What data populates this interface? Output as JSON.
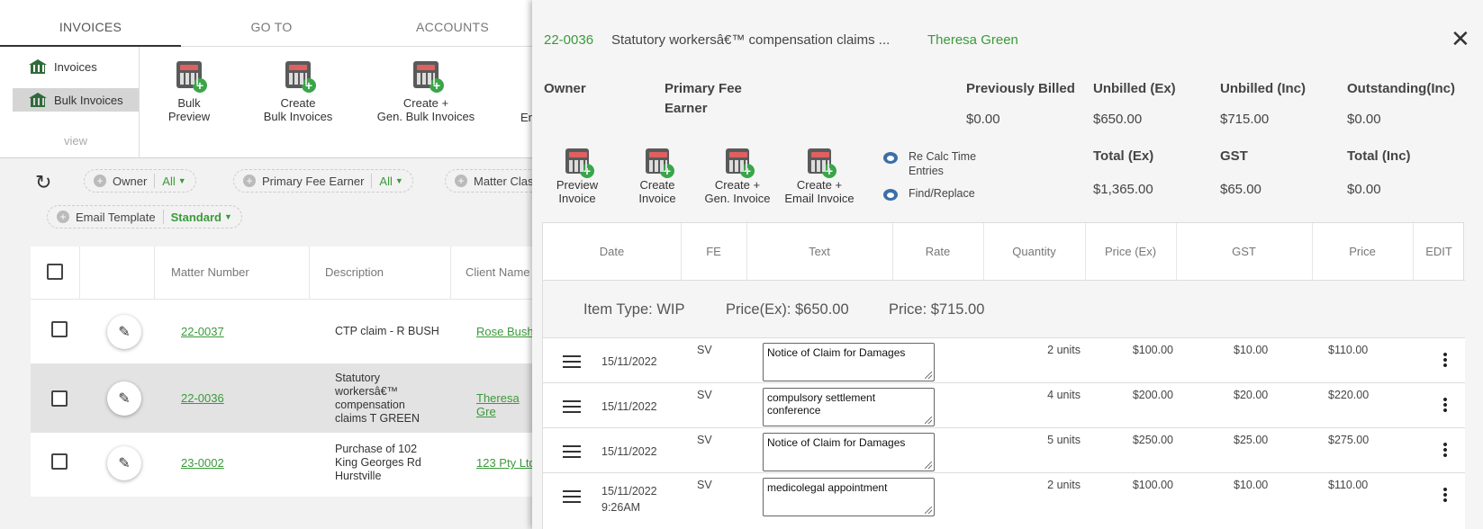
{
  "tabs": {
    "invoices": "INVOICES",
    "goto": "GO TO",
    "accounts": "ACCOUNTS"
  },
  "sidenav": {
    "items": [
      {
        "label": "Invoices",
        "icon": "bank-icon"
      },
      {
        "label": "Bulk Invoices",
        "icon": "bank-icon"
      }
    ],
    "view": "view"
  },
  "toolbar": {
    "bulk_preview": [
      "Bulk",
      "Preview"
    ],
    "create_bulk": [
      "Create",
      "Bulk Invoices"
    ],
    "create_gen_bulk": [
      "Create +",
      "Gen. Bulk Invoices"
    ],
    "truncated": "En"
  },
  "filters": {
    "owner": {
      "label": "Owner",
      "value": "All"
    },
    "fee_earner": {
      "label": "Primary Fee Earner",
      "value": "All"
    },
    "matter_class": {
      "label": "Matter Clas"
    },
    "email_template": {
      "label": "Email Template",
      "value": "Standard"
    }
  },
  "table": {
    "headers": {
      "matter": "Matter Number",
      "desc": "Description",
      "client": "Client Name"
    },
    "rows": [
      {
        "matter": "22-0037",
        "desc": [
          "CTP claim - R BUSH"
        ],
        "client": "Rose Bush"
      },
      {
        "matter": "22-0036",
        "desc": [
          "Statutory",
          "workersâ€™",
          "compensation",
          "claims T GREEN"
        ],
        "client": "Theresa Gre"
      },
      {
        "matter": "23-0002",
        "desc": [
          "Purchase of 102",
          "King Georges Rd",
          "Hurstville"
        ],
        "client": "123 Pty Ltd"
      }
    ]
  },
  "panel": {
    "matter": "22-0036",
    "desc": "Statutory workersâ€™ compensation claims ...",
    "client": "Theresa Green",
    "owner_label": "Owner",
    "fee_earner_label": [
      "Primary Fee",
      "Earner"
    ],
    "summary": {
      "prev_billed": {
        "label": "Previously Billed",
        "value": "$0.00"
      },
      "unbilled_ex": {
        "label": "Unbilled (Ex)",
        "value": "$650.00"
      },
      "unbilled_inc": {
        "label": "Unbilled (Inc)",
        "value": "$715.00"
      },
      "outstanding": {
        "label": "Outstanding(Inc)",
        "value": "$0.00"
      },
      "total_ex": {
        "label": "Total (Ex)",
        "value": "$1,365.00"
      },
      "gst": {
        "label": "GST",
        "value": "$65.00"
      },
      "total_inc": {
        "label": "Total (Inc)",
        "value": "$0.00"
      }
    },
    "actions": {
      "preview": [
        "Preview",
        "Invoice"
      ],
      "create": [
        "Create",
        "Invoice"
      ],
      "create_gen": [
        "Create +",
        "Gen. Invoice"
      ],
      "create_email": [
        "Create +",
        "Email Invoice"
      ],
      "recalc": [
        "Re Calc Time",
        "Entries"
      ],
      "find_replace": "Find/Replace"
    },
    "grid": {
      "headers": [
        "Date",
        "FE",
        "Text",
        "Rate",
        "Quantity",
        "Price (Ex)",
        "GST",
        "Price",
        "EDIT"
      ],
      "group": {
        "type": "Item Type: WIP",
        "price_ex": "Price(Ex): $650.00",
        "price": "Price: $715.00"
      },
      "rows": [
        {
          "date": "15/11/2022",
          "time": "",
          "fe": "SV",
          "text": "Notice of Claim for Damages",
          "qty": "2 units",
          "price_ex": "$100.00",
          "gst": "$10.00",
          "price": "$110.00"
        },
        {
          "date": "15/11/2022",
          "time": "",
          "fe": "SV",
          "text": "compulsory settlement conference",
          "qty": "4 units",
          "price_ex": "$200.00",
          "gst": "$20.00",
          "price": "$220.00"
        },
        {
          "date": "15/11/2022",
          "time": "",
          "fe": "SV",
          "text": "Notice of Claim for Damages",
          "qty": "5 units",
          "price_ex": "$250.00",
          "gst": "$25.00",
          "price": "$275.00"
        },
        {
          "date": "15/11/2022",
          "time": "9:26AM",
          "fe": "SV",
          "text": "medicolegal appointment",
          "qty": "2 units",
          "price_ex": "$100.00",
          "gst": "$10.00",
          "price": "$110.00"
        }
      ]
    }
  }
}
